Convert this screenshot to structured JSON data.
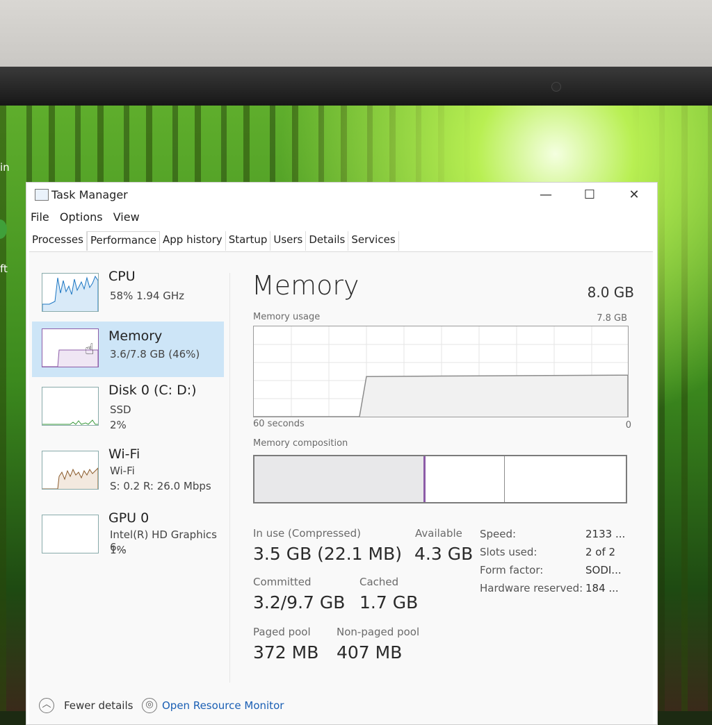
{
  "window": {
    "title": "Task Manager",
    "controls": {
      "minimize": "—",
      "maximize": "☐",
      "close": "✕"
    }
  },
  "desktop": {
    "partial_labels": [
      "in",
      "ft"
    ]
  },
  "menu": {
    "items": [
      "File",
      "Options",
      "View"
    ]
  },
  "tabs": [
    "Processes",
    "Performance",
    "App history",
    "Startup",
    "Users",
    "Details",
    "Services"
  ],
  "active_tab": "Performance",
  "sidebar": {
    "items": [
      {
        "name": "CPU",
        "line1": "58%  1.94 GHz",
        "line2": ""
      },
      {
        "name": "Memory",
        "line1": "3.6/7.8 GB (46%)",
        "line2": ""
      },
      {
        "name": "Disk 0 (C: D:)",
        "line1": "SSD",
        "line2": "2%"
      },
      {
        "name": "Wi-Fi",
        "line1": "Wi-Fi",
        "line2": "S: 0.2  R: 26.0 Mbps"
      },
      {
        "name": "GPU 0",
        "line1": "Intel(R) HD Graphics 6...",
        "line2": "1%"
      }
    ],
    "selected_index": 1
  },
  "memory": {
    "heading": "Memory",
    "total": "8.0 GB",
    "usage_label": "Memory usage",
    "usage_max": "7.8 GB",
    "time_left": "60 seconds",
    "time_right": "0",
    "composition_label": "Memory composition",
    "usage_fraction": 0.46,
    "stats": {
      "in_use_label": "In use (Compressed)",
      "in_use_value": "3.5 GB (22.1 MB)",
      "available_label": "Available",
      "available_value": "4.3 GB",
      "committed_label": "Committed",
      "committed_value": "3.2/9.7 GB",
      "cached_label": "Cached",
      "cached_value": "1.7 GB",
      "paged_label": "Paged pool",
      "paged_value": "372 MB",
      "nonpaged_label": "Non-paged pool",
      "nonpaged_value": "407 MB"
    },
    "specs": [
      {
        "label": "Speed:",
        "value": "2133 ..."
      },
      {
        "label": "Slots used:",
        "value": "2 of 2"
      },
      {
        "label": "Form factor:",
        "value": "SODI..."
      },
      {
        "label": "Hardware reserved:",
        "value": "184 ..."
      }
    ]
  },
  "footer": {
    "fewer_details": "Fewer details",
    "resource_monitor": "Open Resource Monitor"
  },
  "colors": {
    "selected_bg": "#cde5f7",
    "memory_line": "#8c5ca8",
    "cpu_line": "#1a75c2",
    "disk_line": "#3a9a3a",
    "wifi_line": "#8a5a2a",
    "link": "#1a5fb4"
  }
}
